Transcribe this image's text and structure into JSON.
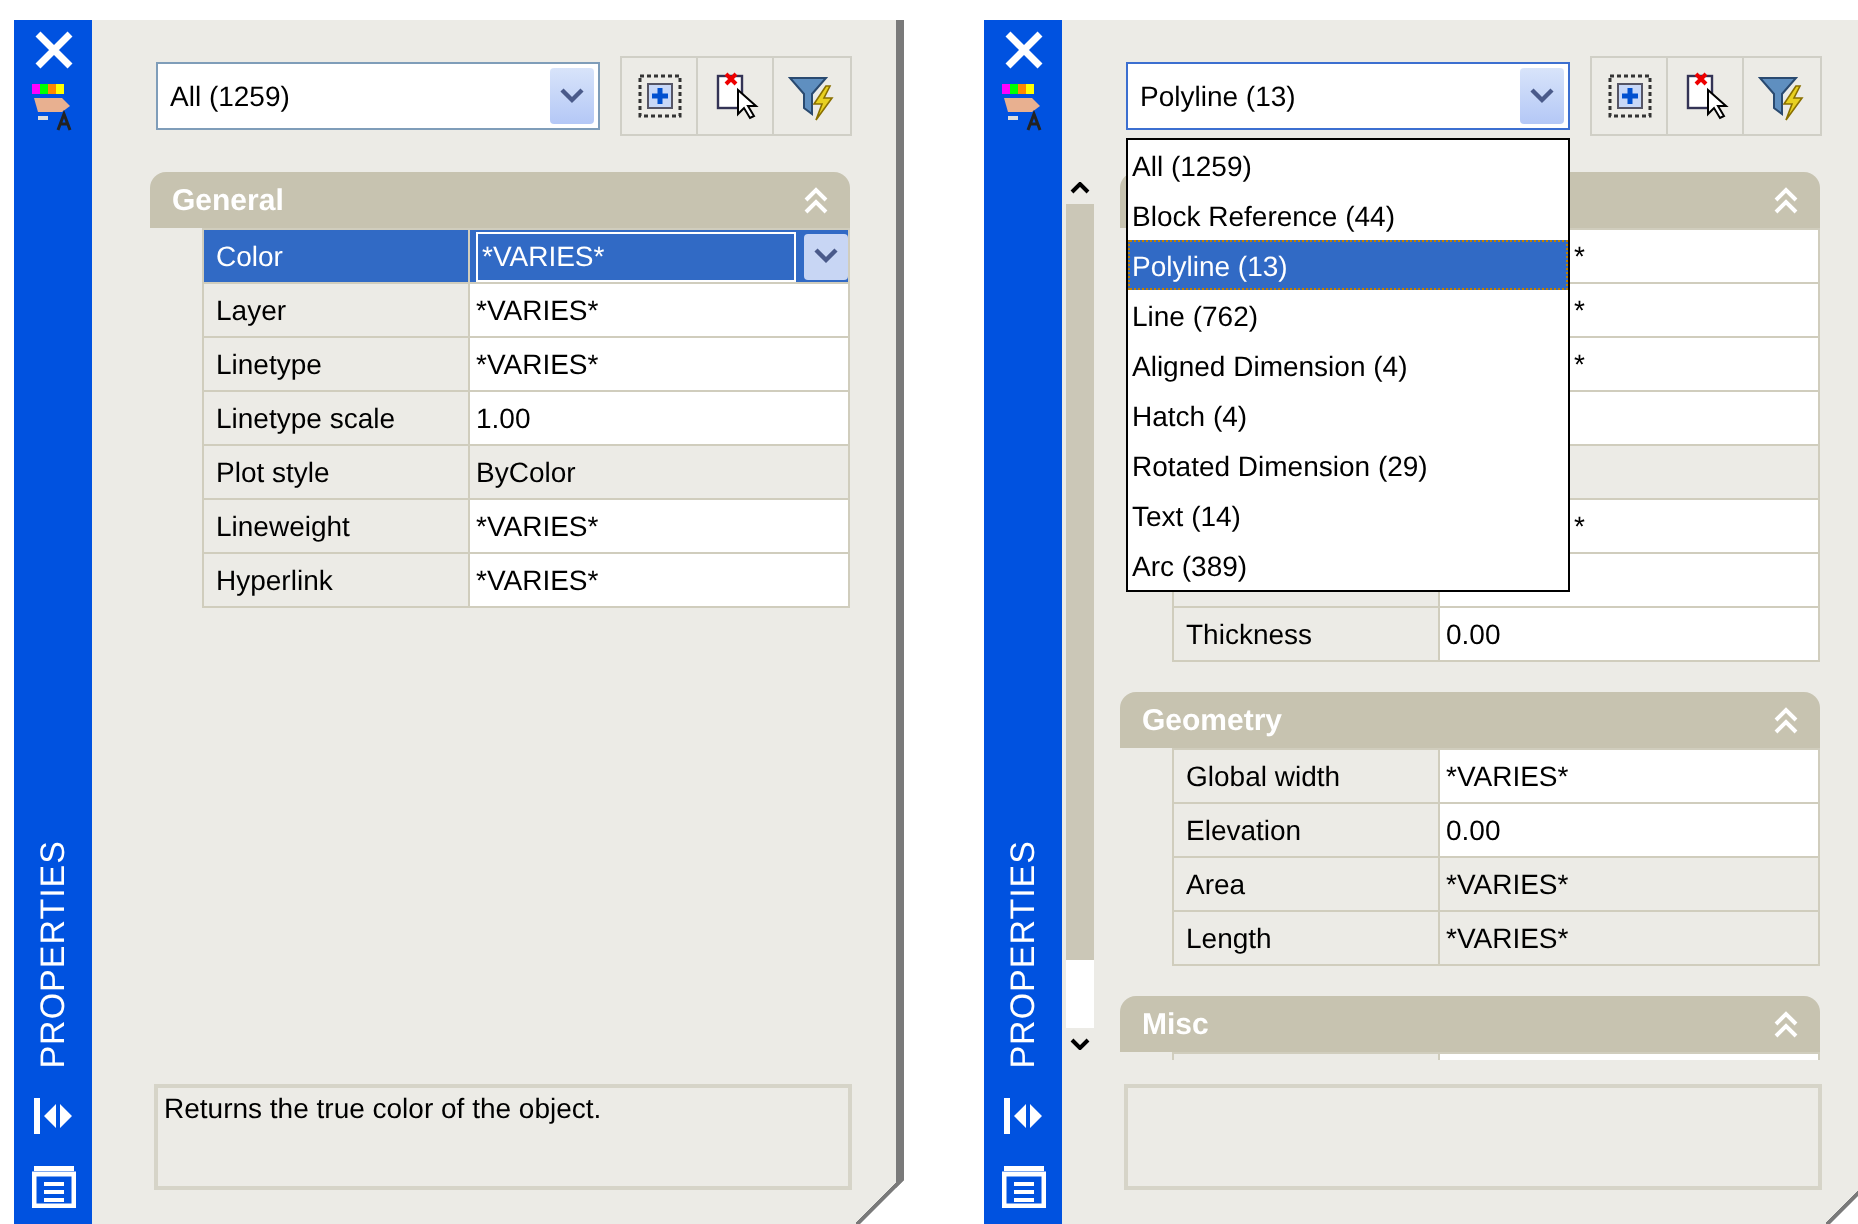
{
  "panels": [
    {
      "sidebar_title": "PROPERTIES",
      "selector": {
        "value": "All (1259)",
        "open": false
      },
      "scrollbar": false,
      "sections": [
        {
          "title": "General",
          "expanded": true,
          "rows": [
            {
              "label": "Color",
              "value": "*VARIES*",
              "editable": true,
              "selected": true
            },
            {
              "label": "Layer",
              "value": "*VARIES*",
              "editable": true,
              "selected": false
            },
            {
              "label": "Linetype",
              "value": "*VARIES*",
              "editable": true,
              "selected": false
            },
            {
              "label": "Linetype scale",
              "value": "1.00",
              "editable": true,
              "selected": false
            },
            {
              "label": "Plot style",
              "value": "ByColor",
              "editable": false,
              "selected": false
            },
            {
              "label": "Lineweight",
              "value": "*VARIES*",
              "editable": true,
              "selected": false
            },
            {
              "label": "Hyperlink",
              "value": "*VARIES*",
              "editable": true,
              "selected": false
            }
          ]
        }
      ],
      "description": "Returns the true color of the object."
    },
    {
      "sidebar_title": "PROPERTIES",
      "selector": {
        "value": "Polyline (13)",
        "open": true,
        "options": [
          {
            "label": "All (1259)",
            "selected": false
          },
          {
            "label": "Block Reference (44)",
            "selected": false
          },
          {
            "label": "Polyline (13)",
            "selected": true
          },
          {
            "label": "Line (762)",
            "selected": false
          },
          {
            "label": "Aligned Dimension (4)",
            "selected": false
          },
          {
            "label": "Hatch (4)",
            "selected": false
          },
          {
            "label": "Rotated Dimension (29)",
            "selected": false
          },
          {
            "label": "Text (14)",
            "selected": false
          },
          {
            "label": "Arc (389)",
            "selected": false
          }
        ]
      },
      "scrollbar": true,
      "sections": [
        {
          "expanded": true,
          "rows": [
            {
              "value": "*",
              "editable": true
            },
            {
              "value": "*",
              "editable": true
            },
            {
              "value": "*",
              "editable": true
            },
            {
              "editable": true
            },
            {},
            {
              "value": "*",
              "editable": true
            },
            {
              "editable": true
            },
            {
              "label": "Thickness",
              "value": "0.00",
              "editable": true,
              "selected": false
            }
          ]
        },
        {
          "title": "Geometry",
          "expanded": true,
          "rows": [
            {
              "label": "Global width",
              "value": "*VARIES*",
              "editable": true,
              "selected": false
            },
            {
              "label": "Elevation",
              "value": "0.00",
              "editable": true,
              "selected": false
            },
            {
              "label": "Area",
              "value": "*VARIES*",
              "editable": false,
              "selected": false
            },
            {
              "label": "Length",
              "value": "*VARIES*",
              "editable": false,
              "selected": false
            }
          ]
        },
        {
          "title": "Misc",
          "expanded": true,
          "rows": [
            {
              "editable": true
            }
          ]
        }
      ]
    }
  ]
}
